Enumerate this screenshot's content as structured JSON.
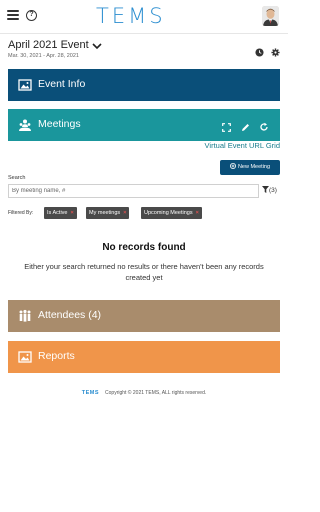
{
  "header": {
    "logo_text": "TEMS",
    "menu_icon": "hamburger-menu-icon",
    "help_icon": "question-mark-icon"
  },
  "event": {
    "title": "April 2021 Event",
    "dates": "Mar. 30, 2021 - Apr. 28, 2021",
    "icons": [
      "clock-icon",
      "gear-icon"
    ]
  },
  "panels": {
    "event_info": "Event Info",
    "meetings": "Meetings",
    "attendees": "Attendees (4)",
    "reports": "Reports"
  },
  "meetings": {
    "grid_link": "Virtual Event URL Grid",
    "new_button": "New Meeting",
    "search_label": "Search",
    "search_placeholder": "By meeting name, #",
    "filter_count": "(3)",
    "filtered_by_label": "Filtered By:",
    "filters": [
      "Is Active",
      "My meetings",
      "Upcoming Meetings"
    ]
  },
  "empty_state": {
    "title": "No records found",
    "message": "Either your search returned no results or there haven't been any records created yet"
  },
  "footer": {
    "logo": "TEMS",
    "copyright": "Copyright © 2021 TEMS, ALL rights reserved."
  },
  "colors": {
    "event_info": "#0a4f79",
    "meetings": "#1a969c",
    "attendees": "#a98c6c",
    "reports": "#f0954a",
    "brand": "#2b8ed0"
  }
}
